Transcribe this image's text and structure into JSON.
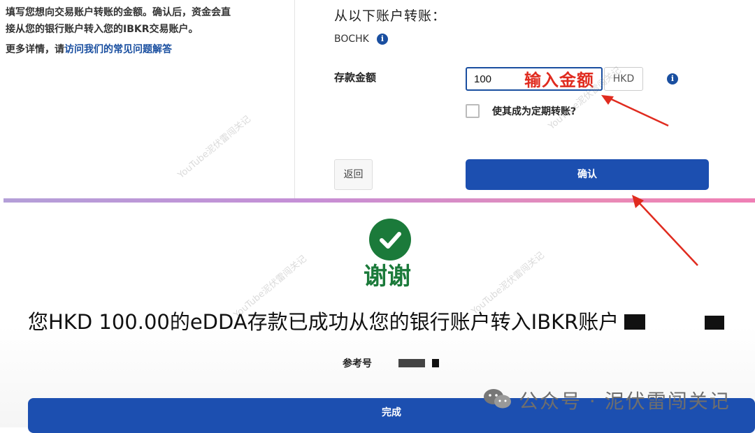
{
  "left_panel": {
    "instruction_line1": "填写您想向交易账户转账的金额。确认后，资金会直",
    "instruction_line2": "接从您的银行账户转入您的IBKR交易账户。",
    "more_prefix": "更多详情，请",
    "faq_link": "访问我们的常见问题解答"
  },
  "transfer": {
    "from_title": "从以下账户转账：",
    "bank_name": "BOCHK",
    "info_glyph": "i",
    "amount_label": "存款金额",
    "amount_value": "100",
    "currency": "HKD",
    "recurring_label": "使其成为定期转账?",
    "recurring_checked": false,
    "back_label": "返回",
    "confirm_label": "确认"
  },
  "annotation": {
    "text": "输入金额",
    "color": "#e02b1f"
  },
  "success": {
    "thanks": "谢谢",
    "message": "您HKD 100.00的eDDA存款已成功从您的银行账户转入IBKR账户",
    "reference_label": "参考号",
    "done_label": "完成"
  },
  "watermark": {
    "text": "公众号 · 泥伏雷闯关记",
    "diagonal": "YouTube泥伏雷闯关记"
  },
  "colors": {
    "primary": "#1c4fb0",
    "success": "#1b7a3a",
    "link": "#1a4fa0"
  }
}
